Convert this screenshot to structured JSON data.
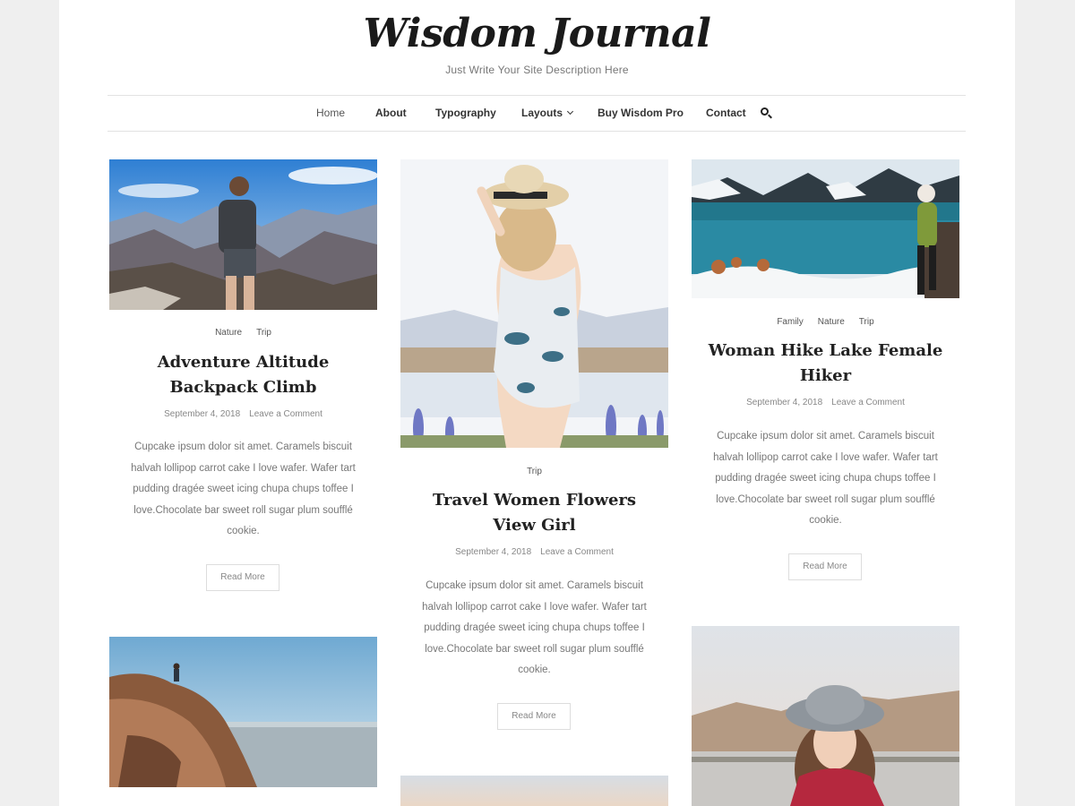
{
  "site": {
    "title": "Wisdom Journal",
    "description": "Just Write Your Site Description Here"
  },
  "nav": {
    "items": [
      {
        "label": "Home",
        "active": true
      },
      {
        "label": "About"
      },
      {
        "label": "Typography"
      },
      {
        "label": "Layouts",
        "dropdown": true
      },
      {
        "label": "Buy Wisdom Pro"
      },
      {
        "label": "Contact"
      }
    ],
    "search_icon": "search-icon"
  },
  "posts": [
    {
      "categories": [
        "Nature",
        "Trip"
      ],
      "title": "Adventure Altitude Backpack Climb",
      "date": "September 4, 2018",
      "comments": "Leave a Comment",
      "excerpt": "Cupcake ipsum dolor sit amet. Caramels biscuit halvah lollipop carrot cake I love wafer. Wafer tart pudding dragée sweet icing chupa chups toffee I love.Chocolate bar sweet roll sugar plum soufflé cookie.",
      "read_more": "Read More",
      "image": "hiker with backpack on mountain summit"
    },
    {
      "categories": [
        "Trip"
      ],
      "title": "Travel Women Flowers View Girl",
      "date": "September 4, 2018",
      "comments": "Leave a Comment",
      "excerpt": "Cupcake ipsum dolor sit amet. Caramels biscuit halvah lollipop carrot cake I love wafer. Wafer tart pudding dragée sweet icing chupa chups toffee I love.Chocolate bar sweet roll sugar plum soufflé cookie.",
      "read_more": "Read More",
      "image": "woman in sun hat and floral romper by lake"
    },
    {
      "categories": [
        "Family",
        "Nature",
        "Trip"
      ],
      "title": "Woman Hike Lake Female Hiker",
      "date": "September 4, 2018",
      "comments": "Leave a Comment",
      "excerpt": "Cupcake ipsum dolor sit amet. Caramels biscuit halvah lollipop carrot cake I love wafer. Wafer tart pudding dragée sweet icing chupa chups toffee I love.Chocolate bar sweet roll sugar plum soufflé cookie.",
      "read_more": "Read More",
      "image": "woman hiker beside turquoise mountain lake"
    },
    {
      "image": "person sitting on rocky cliff above sea"
    },
    {
      "image": "pale sky horizon"
    },
    {
      "image": "woman in grey hat by mountain lake"
    }
  ],
  "colors": {
    "page_background": "#efefef",
    "content_background": "#ffffff",
    "title_text": "#222222",
    "body_text": "#777777",
    "divider": "#e2e2e2"
  }
}
